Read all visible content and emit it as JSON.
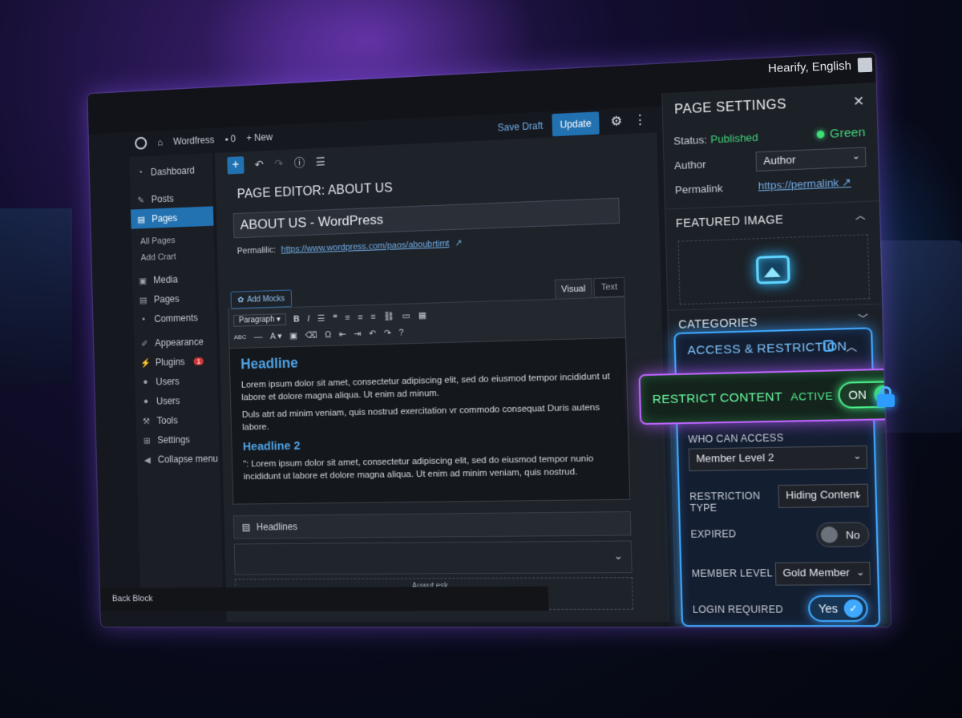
{
  "topbar": {
    "language": "Hearify, English"
  },
  "adminbar": {
    "site_name": "Wordfress",
    "comments_count": "0",
    "new_label": "New"
  },
  "sidebar": {
    "items": [
      {
        "label": "Dashboard",
        "icon": "dashboard-icon"
      },
      {
        "label": "Posts",
        "icon": "pin-icon"
      },
      {
        "label": "Pages",
        "icon": "pages-icon",
        "active": true
      },
      {
        "label": "All Pages"
      },
      {
        "label": "Add Crart"
      },
      {
        "label": "Media",
        "icon": "media-icon"
      },
      {
        "label": "Pages",
        "icon": "pages-icon"
      },
      {
        "label": "Comments",
        "icon": "comments-icon"
      },
      {
        "label": "Appearance",
        "icon": "brush-icon"
      },
      {
        "label": "Plugins",
        "icon": "plugin-icon",
        "badge": "1"
      },
      {
        "label": "Users",
        "icon": "users-icon"
      },
      {
        "label": "Users",
        "icon": "user-icon"
      },
      {
        "label": "Tools",
        "icon": "wrench-icon"
      },
      {
        "label": "Settings",
        "icon": "settings-icon"
      },
      {
        "label": "Collapse menu",
        "icon": "collapse-icon"
      }
    ]
  },
  "editor": {
    "heading": "PAGE EDITOR: ABOUT US",
    "title_value": "ABOUT US - WordPress",
    "permalink_label": "Permalilic:",
    "permalink_url": "https://www.wordpress.com/paos/aboubrtimt",
    "add_media_label": "Add Mocks",
    "tab_visual": "Visual",
    "tab_text": "Text",
    "format_select": "Paragraph",
    "content": {
      "headline": "Headline",
      "paragraph1": "Lorem ipsum dolor sit amet, consectetur adipiscing elit, sed do eiusmod tempor incididunt ut labore et dolore magna aliqua. Ut enim ad minum.",
      "paragraph2": "Duls atrt ad minim veniam, quis nostrud exercitation vr commodo consequat Duris autens labore.",
      "headline2": "Headline 2",
      "paragraph3": "\": Lorem ipsum dolor sit amet, consectetur adipiscing elit, sed do eiusmod tempor nunio incididunt ut labore et dolore magna aliqua. Ut enim ad minim veniam, quis nostrud."
    },
    "headlines_label": "Headlines",
    "dashed_label": "Auwut esk",
    "bottom_label": "Back Block"
  },
  "actions": {
    "save_draft": "Save Draft",
    "update": "Update"
  },
  "page_settings": {
    "title": "PAGE SETTINGS",
    "status_label": "Status:",
    "status_value": "Published",
    "status_indicator": "Green",
    "author_label": "Author",
    "author_value": "Author",
    "permalink_label": "Permalink",
    "permalink_value": "https://permalink",
    "featured_image_label": "FEATURED IMAGE",
    "categories_label": "CATEGORIES"
  },
  "access": {
    "title": "ACCESS & RESTRICTION",
    "restrict_label": "RESTRICT CONTENT",
    "restrict_state": "ACTIVE",
    "restrict_toggle": "ON",
    "who_label": "WHO CAN ACCESS",
    "who_value": "Member Level 2",
    "type_label": "RESTRICTION TYPE",
    "type_value": "Hiding Content",
    "expired_label": "EXPIRED",
    "expired_value": "No",
    "member_label": "MEMBER LEVEL",
    "member_value": "Gold Member",
    "login_label": "LOGIN REQUIRED",
    "login_value": "Yes"
  },
  "colors": {
    "accent": "#2271b1",
    "glow_blue": "#3fa9ff",
    "glow_green": "#3ee07a",
    "glow_purple": "#c065ff"
  }
}
